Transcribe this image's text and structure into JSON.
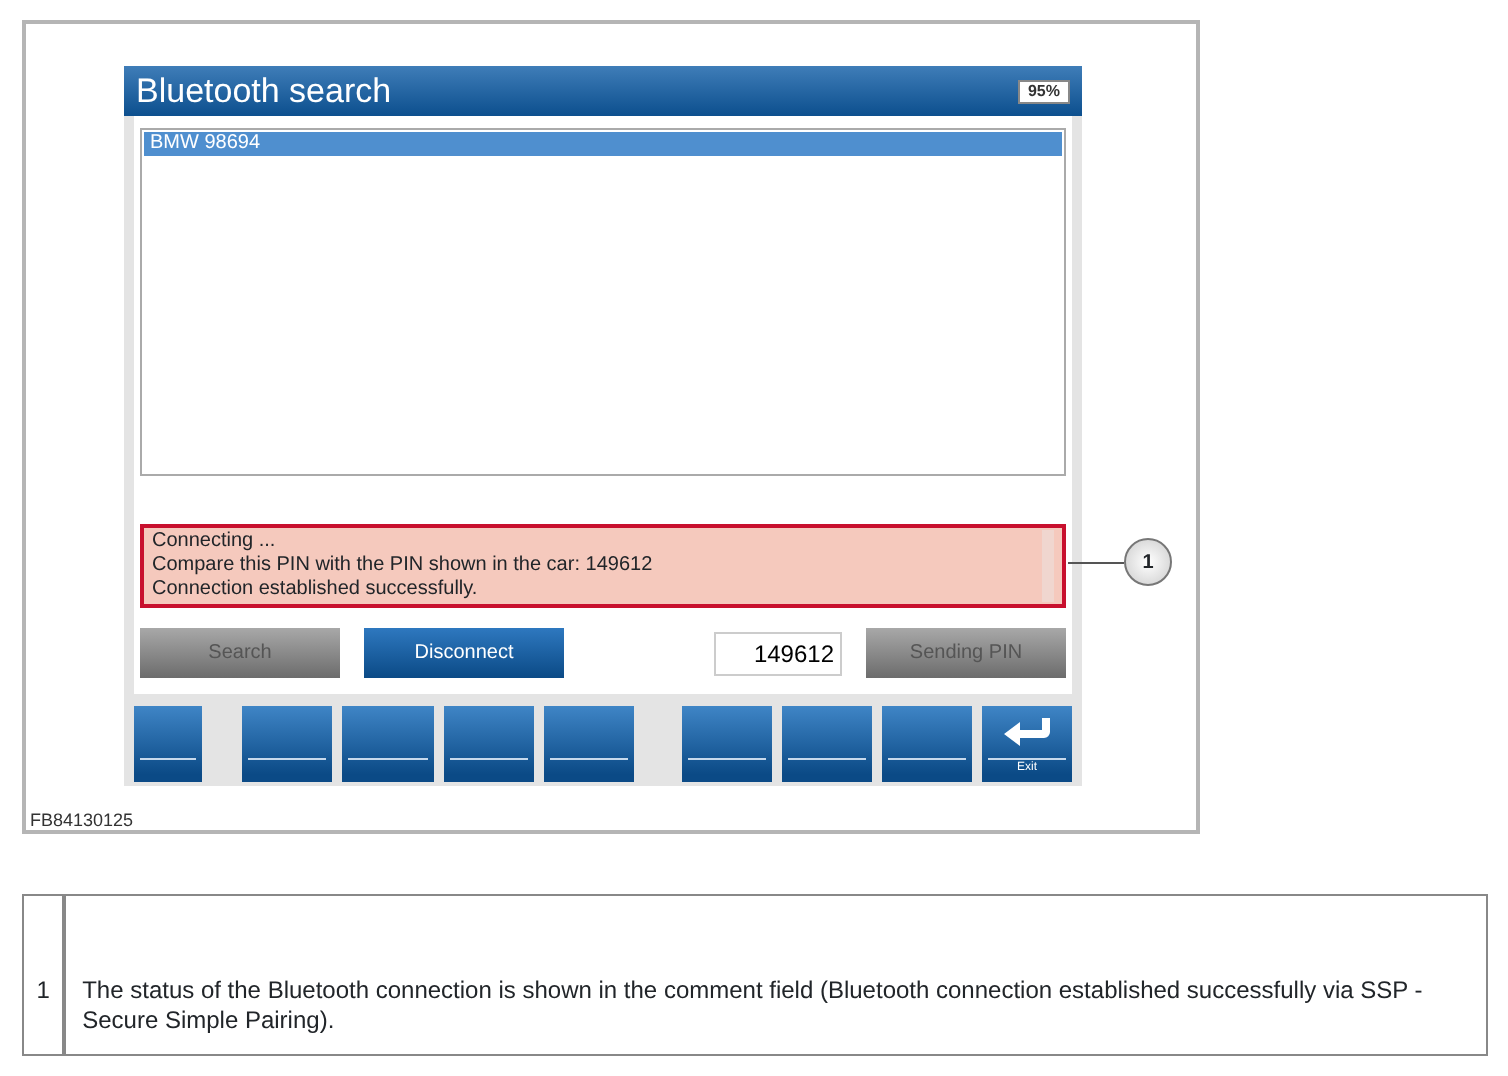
{
  "screen": {
    "title": "Bluetooth search",
    "battery": "95%",
    "devices": [
      {
        "name": "BMW 98694",
        "selected": true
      }
    ],
    "comment_lines": [
      "Connecting ...",
      "Compare this PIN with the PIN shown in the car: 149612",
      "Connection established successfully."
    ],
    "comment_highlighted": true,
    "buttons": [
      {
        "label": "Search",
        "disabled": true
      },
      {
        "label": "Disconnect",
        "disabled": false
      }
    ],
    "pin_field": {
      "value": "149612"
    },
    "send_button": {
      "label": "Sending PIN",
      "disabled": true
    },
    "softkeys": [
      {
        "kind": "narrow"
      },
      {
        "kind": "blank"
      },
      {
        "kind": "blank"
      },
      {
        "kind": "blank"
      },
      {
        "kind": "blank"
      },
      {
        "kind": "gap"
      },
      {
        "kind": "blank"
      },
      {
        "kind": "blank"
      },
      {
        "kind": "blank"
      },
      {
        "kind": "exit",
        "label": "Exit"
      }
    ]
  },
  "callout": "1",
  "figure_id": "FB84130125",
  "legend": [
    {
      "number": "1",
      "text": "The status of the Bluetooth connection is shown in the comment field (Bluetooth connection established successfully via SSP - Secure Simple Pairing)."
    }
  ]
}
